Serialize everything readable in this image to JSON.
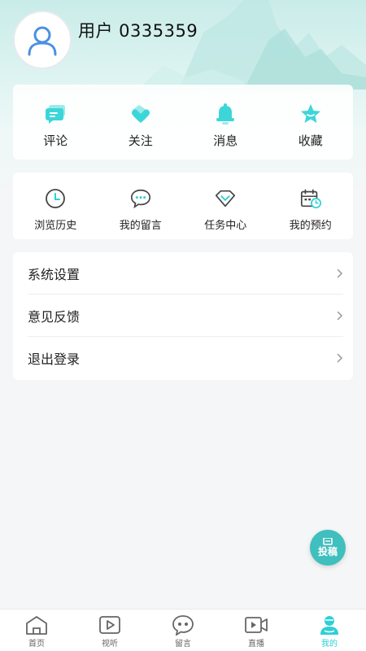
{
  "profile": {
    "username": "用户 0335359",
    "avatar_icon": "user-avatar-icon"
  },
  "quick_actions": [
    {
      "label": "评论",
      "icon": "comment-icon"
    },
    {
      "label": "关注",
      "icon": "follow-icon"
    },
    {
      "label": "消息",
      "icon": "bell-icon"
    },
    {
      "label": "收藏",
      "icon": "star-icon"
    }
  ],
  "features": [
    {
      "label": "浏览历史",
      "icon": "clock-icon"
    },
    {
      "label": "我的留言",
      "icon": "message-icon"
    },
    {
      "label": "任务中心",
      "icon": "task-icon"
    },
    {
      "label": "我的预约",
      "icon": "calendar-icon"
    }
  ],
  "settings": [
    {
      "label": "系统设置"
    },
    {
      "label": "意见反馈"
    },
    {
      "label": "退出登录"
    }
  ],
  "fab": {
    "label": "投稿",
    "icon": "contribute-icon"
  },
  "tabbar": [
    {
      "label": "首页",
      "icon": "home-icon"
    },
    {
      "label": "视听",
      "icon": "video-play-icon"
    },
    {
      "label": "留言",
      "icon": "chat-bubble-icon"
    },
    {
      "label": "直播",
      "icon": "live-camera-icon"
    },
    {
      "label": "我的",
      "icon": "profile-icon",
      "active": true
    }
  ],
  "colors": {
    "accent": "#2ecfd6",
    "icon_teal": "#3cd6d9",
    "fab": "#3fbfbd"
  }
}
